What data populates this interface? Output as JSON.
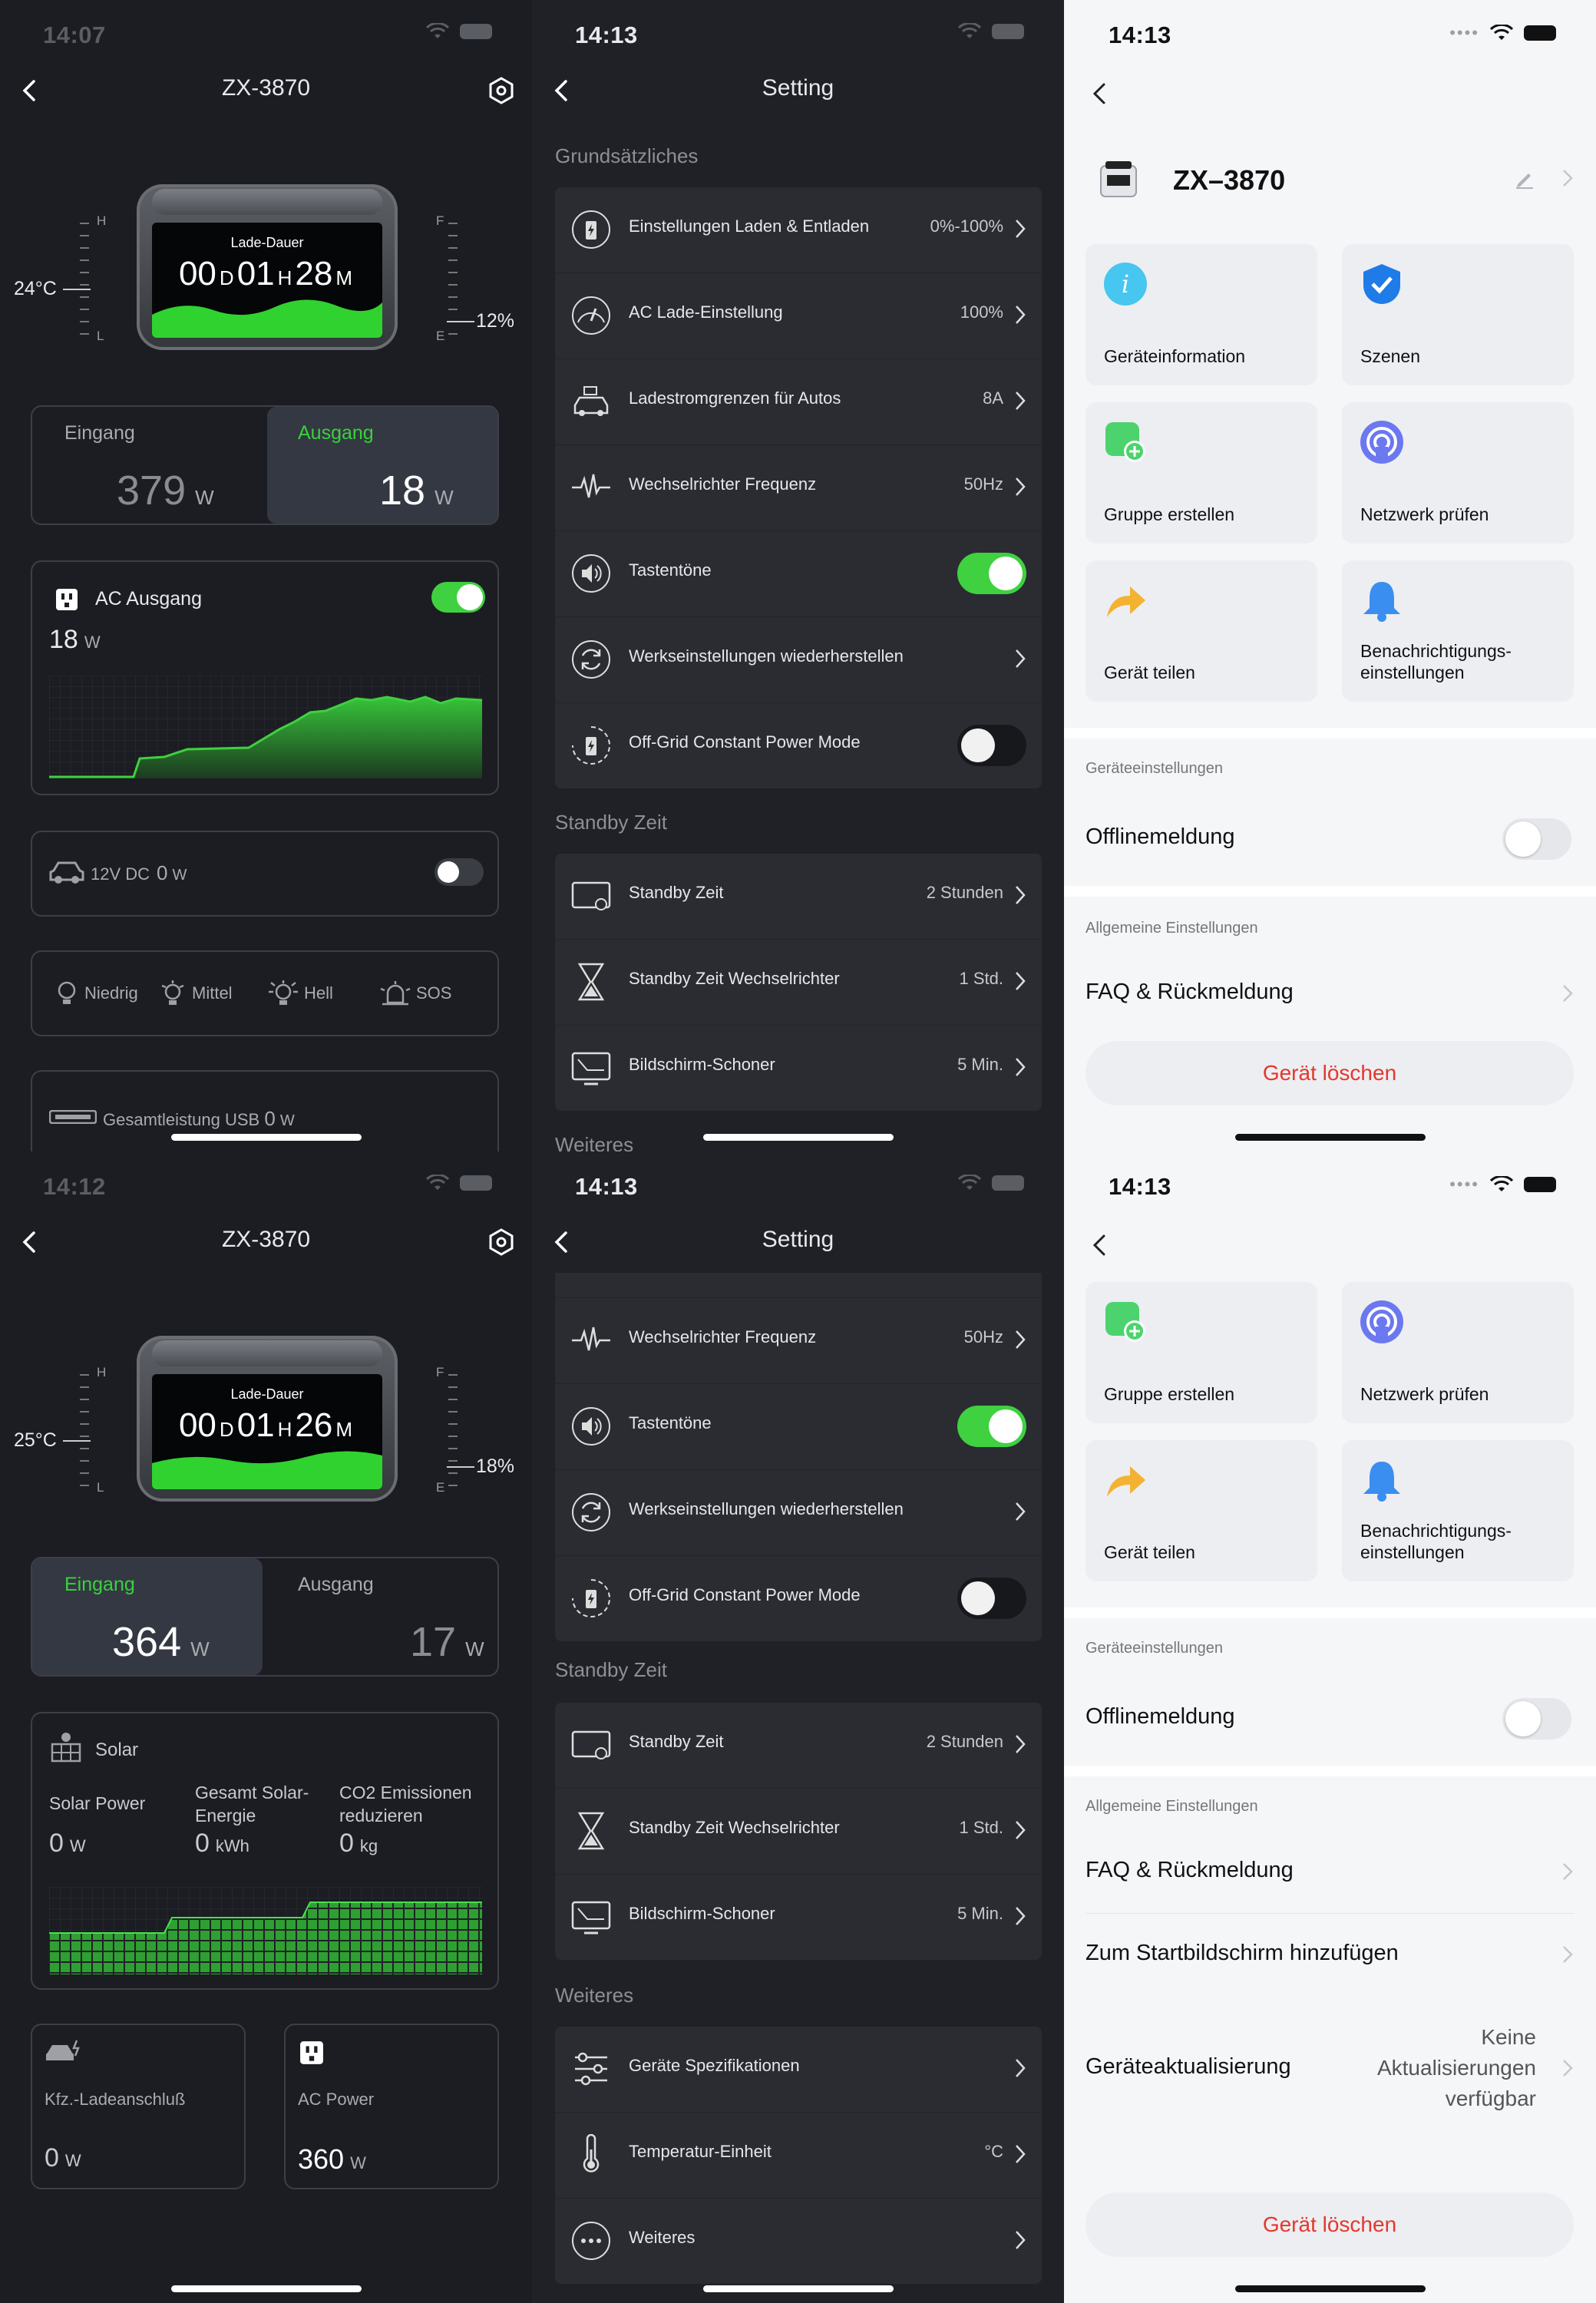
{
  "status": {
    "p1_time": "14:07",
    "p2_time": "14:13",
    "p3_time": "14:13",
    "p4_time": "14:12",
    "p5_time": "14:13",
    "p6_time": "14:13"
  },
  "device": {
    "name": "ZX-3870",
    "name_light": "ZX–3870",
    "lade_label": "Lade-Dauer",
    "unit_d": "D",
    "unit_h": "H",
    "unit_m": "M",
    "gauge_h": "H",
    "gauge_l": "L",
    "gauge_f": "F",
    "gauge_e": "E"
  },
  "p1": {
    "time_d": "00",
    "time_h": "01",
    "time_m": "28",
    "temp": "24°C",
    "battery": "12%",
    "input_label": "Eingang",
    "input_value": "379",
    "output_label": "Ausgang",
    "output_value": "18",
    "unit_w": "W",
    "ac_label": "AC Ausgang",
    "ac_value": "18",
    "dc_label": "12V DC",
    "dc_value": "0",
    "light_low": "Niedrig",
    "light_mid": "Mittel",
    "light_bright": "Hell",
    "light_sos": "SOS",
    "usb_label": "Gesamtleistung USB",
    "usb_value": "0"
  },
  "p4": {
    "time_d": "00",
    "time_h": "01",
    "time_m": "26",
    "temp": "25°C",
    "battery": "18%",
    "input_label": "Eingang",
    "input_value": "364",
    "output_label": "Ausgang",
    "output_value": "17",
    "unit_w": "W",
    "solar_label": "Solar",
    "solar_power_label": "Solar Power",
    "solar_power_value": "0",
    "solar_total_label_1": "Gesamt Solar-",
    "solar_total_label_2": "Energie",
    "solar_total_value": "0",
    "solar_total_unit": "kWh",
    "co2_label_1": "CO2 Emissionen",
    "co2_label_2": "reduzieren",
    "co2_value": "0",
    "co2_unit": "kg",
    "car_label": "Kfz.-Ladeanschluß",
    "car_value": "0",
    "acp_label": "AC Power",
    "acp_value": "360"
  },
  "settings": {
    "title": "Setting",
    "sec_basic": "Grundsätzliches",
    "sec_standby": "Standby Zeit",
    "sec_more": "Weiteres",
    "charge_label": "Einstellungen Laden & Entladen",
    "charge_value": "0%-100%",
    "ac_charge_label": "AC Lade-Einstellung",
    "ac_charge_value": "100%",
    "car_limit_label": "Ladestromgrenzen für Autos",
    "car_limit_value": "8A",
    "freq_label": "Wechselrichter Frequenz",
    "freq_value": "50Hz",
    "beep_label": "Tastentöne",
    "reset_label": "Werkseinstellungen wiederherstellen",
    "offgrid_label": "Off-Grid Constant Power Mode",
    "standby_label": "Standby Zeit",
    "standby_value": "2 Stunden",
    "inv_standby_label": "Standby Zeit Wechselrichter",
    "inv_standby_value": "1 Std.",
    "saver_label": "Bildschirm-Schoner",
    "saver_value": "5 Min.",
    "spec_label": "Geräte Spezifikationen",
    "temp_unit_label": "Temperatur-Einheit",
    "temp_unit_value": "°C",
    "more_label": "Weiteres"
  },
  "menu": {
    "info": "Geräteinformation",
    "scenes": "Szenen",
    "group": "Gruppe erstellen",
    "network": "Netzwerk prüfen",
    "share": "Gerät teilen",
    "notify_1": "Benachrichtigungs-",
    "notify_2": "einstellungen",
    "sec_device": "Geräteeinstellungen",
    "offline": "Offlinemeldung",
    "sec_general": "Allgemeine Einstellungen",
    "faq": "FAQ & Rückmeldung",
    "home": "Zum Startbildschirm hinzufügen",
    "update": "Geräteaktualisierung",
    "update_value_1": "Keine",
    "update_value_2": "Aktualisierungen",
    "update_value_3": "verfügbar",
    "delete": "Gerät löschen"
  },
  "colors": {
    "accent_green": "#3fd13f",
    "danger_red": "#e5372b",
    "dark_bg": "#1b1d22",
    "light_bg": "#f5f6f8"
  }
}
